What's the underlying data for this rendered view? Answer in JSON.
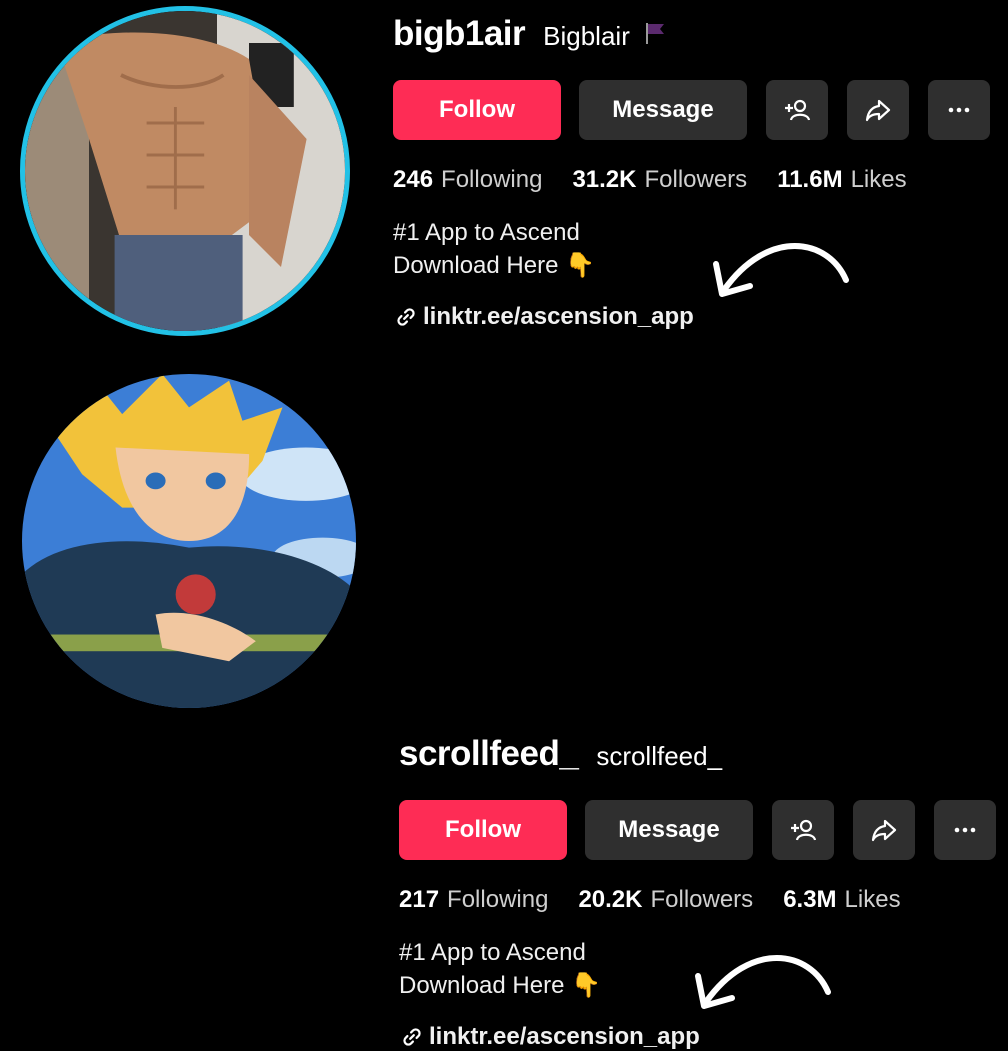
{
  "profiles": [
    {
      "username": "bigb1air",
      "nickname": "Bigblair",
      "flag_icon": "purple-flag-icon",
      "buttons": {
        "follow": "Follow",
        "message": "Message"
      },
      "stats": {
        "following_count": "246",
        "following_label": "Following",
        "followers_count": "31.2K",
        "followers_label": "Followers",
        "likes_count": "11.6M",
        "likes_label": "Likes"
      },
      "bio": {
        "line1": "#1 App to Ascend",
        "line2": "Download Here 👇"
      },
      "link": "linktr.ee/ascension_app",
      "avatar_ring_color": "#22c1e6"
    },
    {
      "username": "scrollfeed_",
      "nickname": "scrollfeed_",
      "buttons": {
        "follow": "Follow",
        "message": "Message"
      },
      "stats": {
        "following_count": "217",
        "following_label": "Following",
        "followers_count": "20.2K",
        "followers_label": "Followers",
        "likes_count": "6.3M",
        "likes_label": "Likes"
      },
      "bio": {
        "line1": "#1 App to Ascend",
        "line2": "Download Here 👇"
      },
      "link": "linktr.ee/ascension_app"
    }
  ],
  "colors": {
    "follow": "#fe2c55",
    "secondary_button": "#2f2f2f",
    "background": "#000000"
  }
}
